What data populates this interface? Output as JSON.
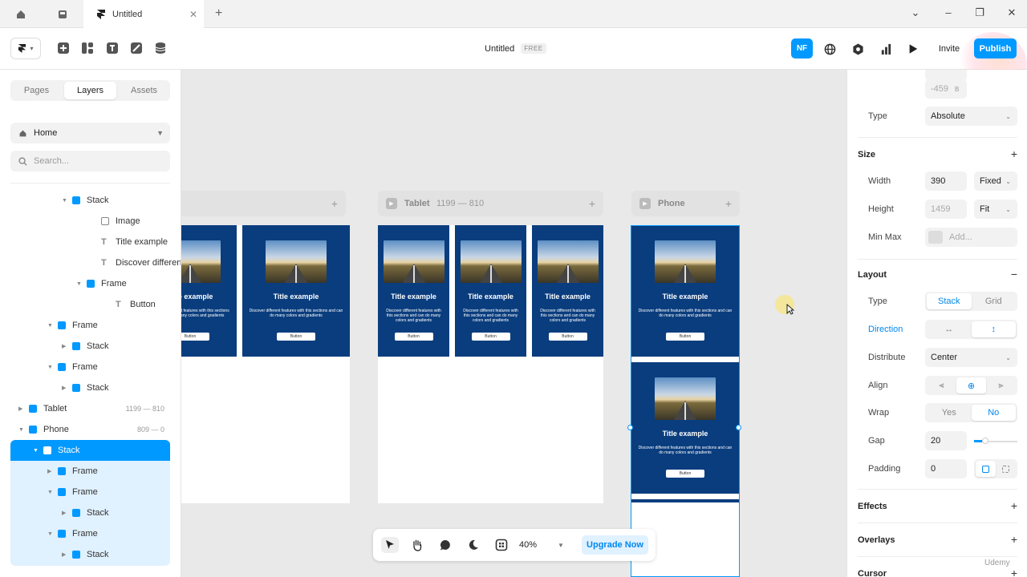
{
  "tabbar": {
    "doc_tab_label": "Untitled",
    "close_glyph": "✕",
    "new_tab_glyph": "+"
  },
  "toolbar": {
    "doc_title": "Untitled",
    "plan_badge": "FREE",
    "avatar_initials": "NF",
    "invite_label": "Invite",
    "publish_label": "Publish"
  },
  "left_panel": {
    "tabs": [
      "Pages",
      "Layers",
      "Assets"
    ],
    "active_tab": "Layers",
    "page_select": "Home",
    "search_placeholder": "Search...",
    "layers": [
      {
        "label": "Stack",
        "icon": "stack",
        "expanded": true
      },
      {
        "label": "Image",
        "icon": "image"
      },
      {
        "label": "Title example",
        "icon": "text"
      },
      {
        "label": "Discover differen",
        "icon": "text"
      },
      {
        "label": "Frame",
        "icon": "frame",
        "expanded": true
      },
      {
        "label": "Button",
        "icon": "text"
      },
      {
        "label": "Frame",
        "icon": "frame",
        "expanded": true
      },
      {
        "label": "Stack",
        "icon": "stack",
        "expanded": false
      },
      {
        "label": "Frame",
        "icon": "frame",
        "expanded": true
      },
      {
        "label": "Stack",
        "icon": "stack",
        "expanded": false
      },
      {
        "label": "Tablet",
        "icon": "frame",
        "dims": "1199 — 810",
        "expanded": false
      },
      {
        "label": "Phone",
        "icon": "frame",
        "dims": "809 — 0",
        "expanded": true
      },
      {
        "label": "Stack",
        "icon": "stack",
        "expanded": true,
        "selected": true
      },
      {
        "label": "Frame",
        "icon": "frame",
        "expanded": false
      },
      {
        "label": "Frame",
        "icon": "frame",
        "expanded": true
      },
      {
        "label": "Stack",
        "icon": "stack",
        "expanded": false
      },
      {
        "label": "Frame",
        "icon": "frame",
        "expanded": true
      },
      {
        "label": "Stack",
        "icon": "stack",
        "expanded": false
      }
    ]
  },
  "canvas": {
    "breakpoints": [
      {
        "name": "Tablet",
        "dims": "1199 — 810"
      },
      {
        "name": "Phone",
        "dims": ""
      }
    ],
    "card": {
      "title": "Title example",
      "description": "Discover different features with this sections and can do many colors and gradients",
      "button": "Button"
    },
    "zoom": "40%",
    "upgrade_label": "Upgrade Now"
  },
  "right_panel": {
    "position_value": "-459",
    "position_suffix": "B",
    "type_label": "Type",
    "type_value": "Absolute",
    "size_heading": "Size",
    "width_label": "Width",
    "width_value": "390",
    "width_mode": "Fixed",
    "height_label": "Height",
    "height_value": "1459",
    "height_mode": "Fit",
    "minmax_label": "Min Max",
    "minmax_placeholder": "Add...",
    "layout_heading": "Layout",
    "layout_type_label": "Type",
    "layout_type_options": [
      "Stack",
      "Grid"
    ],
    "layout_type_selected": "Stack",
    "direction_label": "Direction",
    "direction_selected": "vertical",
    "distribute_label": "Distribute",
    "distribute_value": "Center",
    "align_label": "Align",
    "align_selected": "center",
    "wrap_label": "Wrap",
    "wrap_options": [
      "Yes",
      "No"
    ],
    "wrap_selected": "No",
    "gap_label": "Gap",
    "gap_value": "20",
    "padding_label": "Padding",
    "padding_value": "0",
    "effects_heading": "Effects",
    "overlays_heading": "Overlays",
    "cursor_heading": "Cursor"
  },
  "watermark": "Udemy",
  "colors": {
    "accent": "#0099ff",
    "card_bg": "#0a3d7e"
  }
}
